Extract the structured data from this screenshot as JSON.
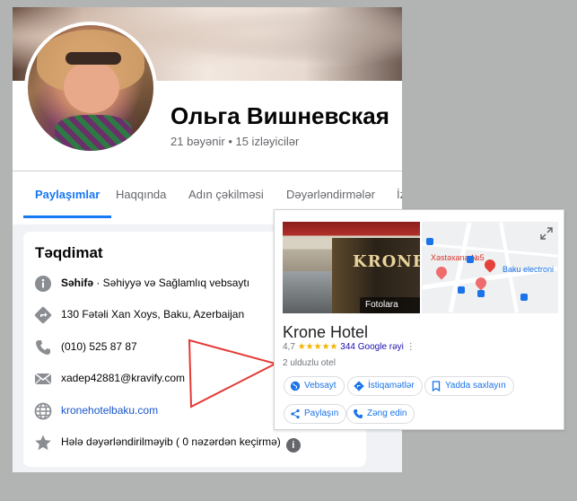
{
  "profile": {
    "name": "Ольга Вишневская",
    "stats": "21 bəyənir • 15 izləyicilər"
  },
  "tabs": [
    {
      "label": "Paylaşımlar",
      "active": true
    },
    {
      "label": "Haqqında"
    },
    {
      "label": "Adın çəkilməsi"
    },
    {
      "label": "Dəyərləndirmələr"
    },
    {
      "label": "İz"
    }
  ],
  "intro": {
    "title": "Təqdimat",
    "page_type_bold": "Səhifə",
    "page_type_rest": " · Səhiyyə və Sağlamlıq vebsaytı",
    "address": "130 Fətəli Xan Xoys, Baku, Azerbaijan",
    "phone": "(010) 525 87 87",
    "email": "xadep42881@kravify.com",
    "website": "kronehotelbaku.com",
    "rating_note": "Hələ dəyərləndirilməyib ( 0 nəzərdən keçirmə)",
    "info_icon_glyph": "i"
  },
  "google_panel": {
    "photo_button": "Fotolara baxın",
    "image_sign": "KRONE",
    "map_labels": {
      "hospital": "Xəstəxana №5",
      "place": "Baku electroni"
    },
    "business_name": "Krone Hotel",
    "rating": "4,7",
    "stars": "★★★★★",
    "reviews": "344 Google rəyi",
    "more": "⋮",
    "category": "2 ulduzlu otel",
    "buttons": {
      "website": "Vebsayt",
      "directions": "İstiqamətlər",
      "save": "Yadda saxlayın",
      "share": "Paylaşın",
      "call": "Zəng edin"
    }
  },
  "colors": {
    "facebook_blue": "#1877f2",
    "google_blue": "#1a73e8",
    "arrow_red": "#e53935",
    "star_yellow": "#f4b400"
  }
}
